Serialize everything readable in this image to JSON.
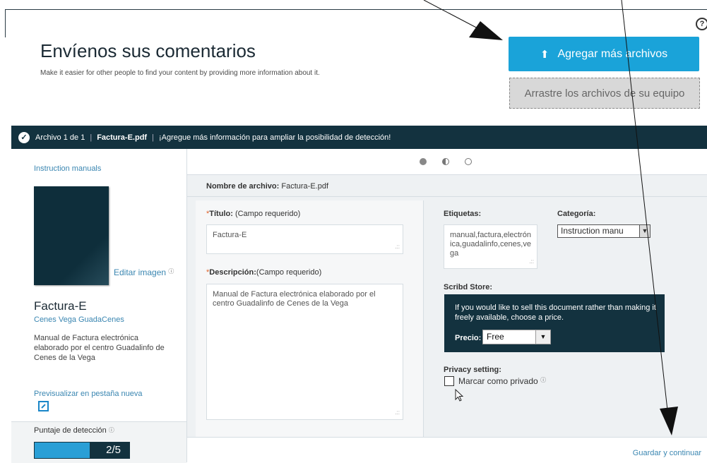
{
  "help_icon": "?",
  "header": {
    "title": "Envíenos sus comentarios",
    "subtitle": "Make it easier for other people to find your content by providing more information about it.",
    "add_button": "Agregar más archivos",
    "drop_text": "Arrastre los archivos de su equipo"
  },
  "status_bar": {
    "file_count": "Archivo 1 de 1",
    "file_name": "Factura-E.pdf",
    "message": "¡Agregue más información para ampliar la posibilidad de detección!"
  },
  "sidebar": {
    "category_link": "Instruction manuals",
    "edit_image": "Editar imagen",
    "doc_title": "Factura-E",
    "doc_author": "Cenes Vega GuadaCenes",
    "doc_description": "Manual de Factura electrónica elaborado por el centro Guadalinfo de Cenes de la Vega",
    "preview_link": "Previsualizar en pestaña nueva",
    "score_label": "Puntaje de detección",
    "score_value": "2/5",
    "score_fraction": 0.4
  },
  "form": {
    "filename_label": "Nombre de archivo:",
    "filename_value": "Factura-E.pdf",
    "title_label": "Título:",
    "title_required": "(Campo requerido)",
    "title_value": "Factura-E",
    "description_label": "Descripción:",
    "description_required": "(Campo requerido)",
    "description_value": "Manual de Factura electrónica elaborado por el centro Guadalinfo de Cenes de la Vega",
    "tags_label": "Etiquetas:",
    "tags_value": "manual,factura,electrónica,guadalinfo,cenes,vega",
    "category_label": "Categoría:",
    "category_value": "Instruction manu",
    "store_label": "Scribd Store:",
    "store_text": "If you would like to sell this document rather than making it freely available, choose a price.",
    "price_label": "Precio:",
    "price_value": "Free",
    "privacy_label": "Privacy setting:",
    "privacy_checkbox": "Marcar como privado",
    "save_link": "Guardar y continuar"
  }
}
